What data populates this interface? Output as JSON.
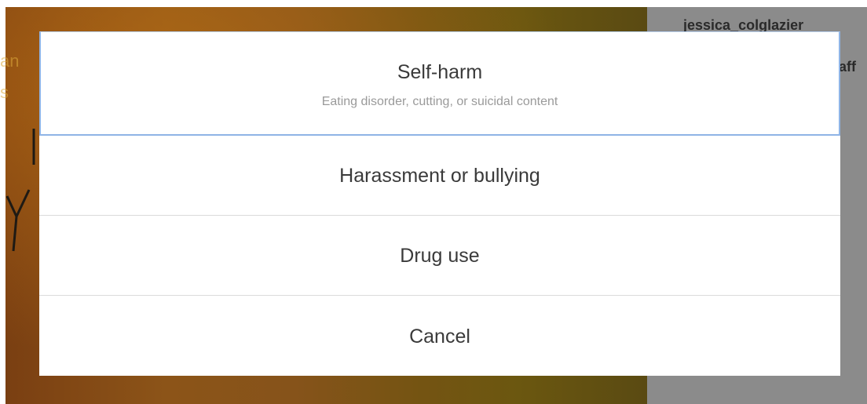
{
  "background": {
    "side_text_line1": "jessica_colglazier",
    "side_text_line2": "aff",
    "left_text_lines": [
      "an",
      "s"
    ]
  },
  "report_menu": {
    "options": [
      {
        "title": "Self-harm",
        "subtitle": "Eating disorder, cutting, or suicidal content"
      },
      {
        "title": "Harassment or bullying"
      },
      {
        "title": "Drug use"
      }
    ],
    "cancel_label": "Cancel"
  },
  "colors": {
    "selected_border": "#8fb4e6",
    "divider": "#dbdbdb",
    "side_panel": "#8b8b8b"
  }
}
